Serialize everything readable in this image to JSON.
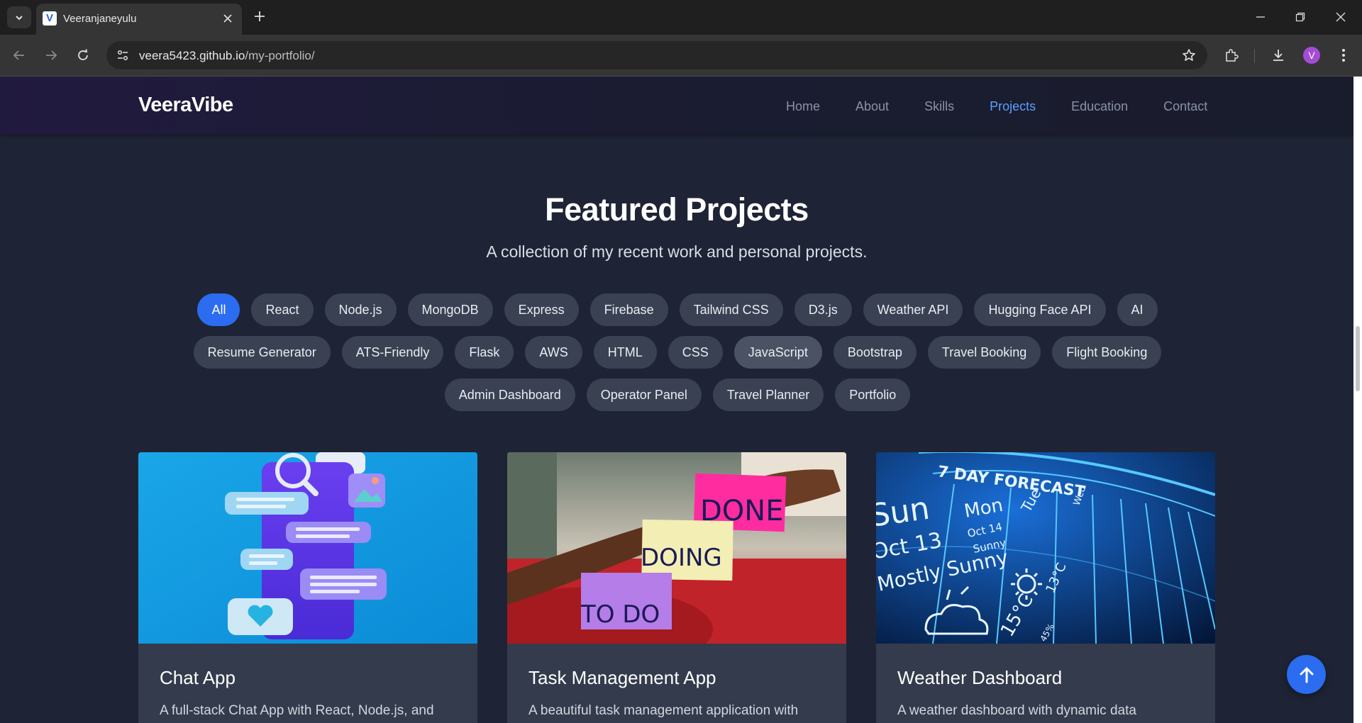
{
  "browser": {
    "tab_title": "Veeranjaneyulu",
    "favicon_letter": "V",
    "url_host": "veera5423.github.io",
    "url_path": "/my-portfolio/",
    "profile_initial": "V"
  },
  "site": {
    "brand": "VeeraVibe",
    "nav": [
      {
        "label": "Home",
        "active": false
      },
      {
        "label": "About",
        "active": false
      },
      {
        "label": "Skills",
        "active": false
      },
      {
        "label": "Projects",
        "active": true
      },
      {
        "label": "Education",
        "active": false
      },
      {
        "label": "Contact",
        "active": false
      }
    ]
  },
  "projects": {
    "heading": "Featured Projects",
    "subheading": "A collection of my recent work and personal projects.",
    "filters": [
      "All",
      "React",
      "Node.js",
      "MongoDB",
      "Express",
      "Firebase",
      "Tailwind CSS",
      "D3.js",
      "Weather API",
      "Hugging Face API",
      "AI",
      "Resume Generator",
      "ATS-Friendly",
      "Flask",
      "AWS",
      "HTML",
      "CSS",
      "JavaScript",
      "Bootstrap",
      "Travel Booking",
      "Flight Booking",
      "Admin Dashboard",
      "Operator Panel",
      "Travel Planner",
      "Portfolio"
    ],
    "active_filter": "All",
    "cards": [
      {
        "title": "Chat App",
        "desc": "A full-stack Chat App with React, Node.js, and",
        "image": "chat-illustration"
      },
      {
        "title": "Task Management App",
        "desc": "A beautiful task management application with",
        "image": "sticky-notes-photo",
        "notes": [
          "DONE",
          "DOING",
          "TO DO"
        ]
      },
      {
        "title": "Weather Dashboard",
        "desc": "A weather dashboard with dynamic data",
        "image": "weather-forecast-screen",
        "forecast": {
          "banner": "7 DAY FORECAST",
          "left_day": "Sun",
          "left_date": "Oct 13",
          "left_cond": "Mostly Sunny",
          "day": "Mon",
          "date": "Oct 14",
          "cond": "Sunny",
          "temp": "15°C",
          "day2": "Tue",
          "temp2": "13°C",
          "day3": "Wed",
          "pct": "45%"
        }
      }
    ]
  }
}
